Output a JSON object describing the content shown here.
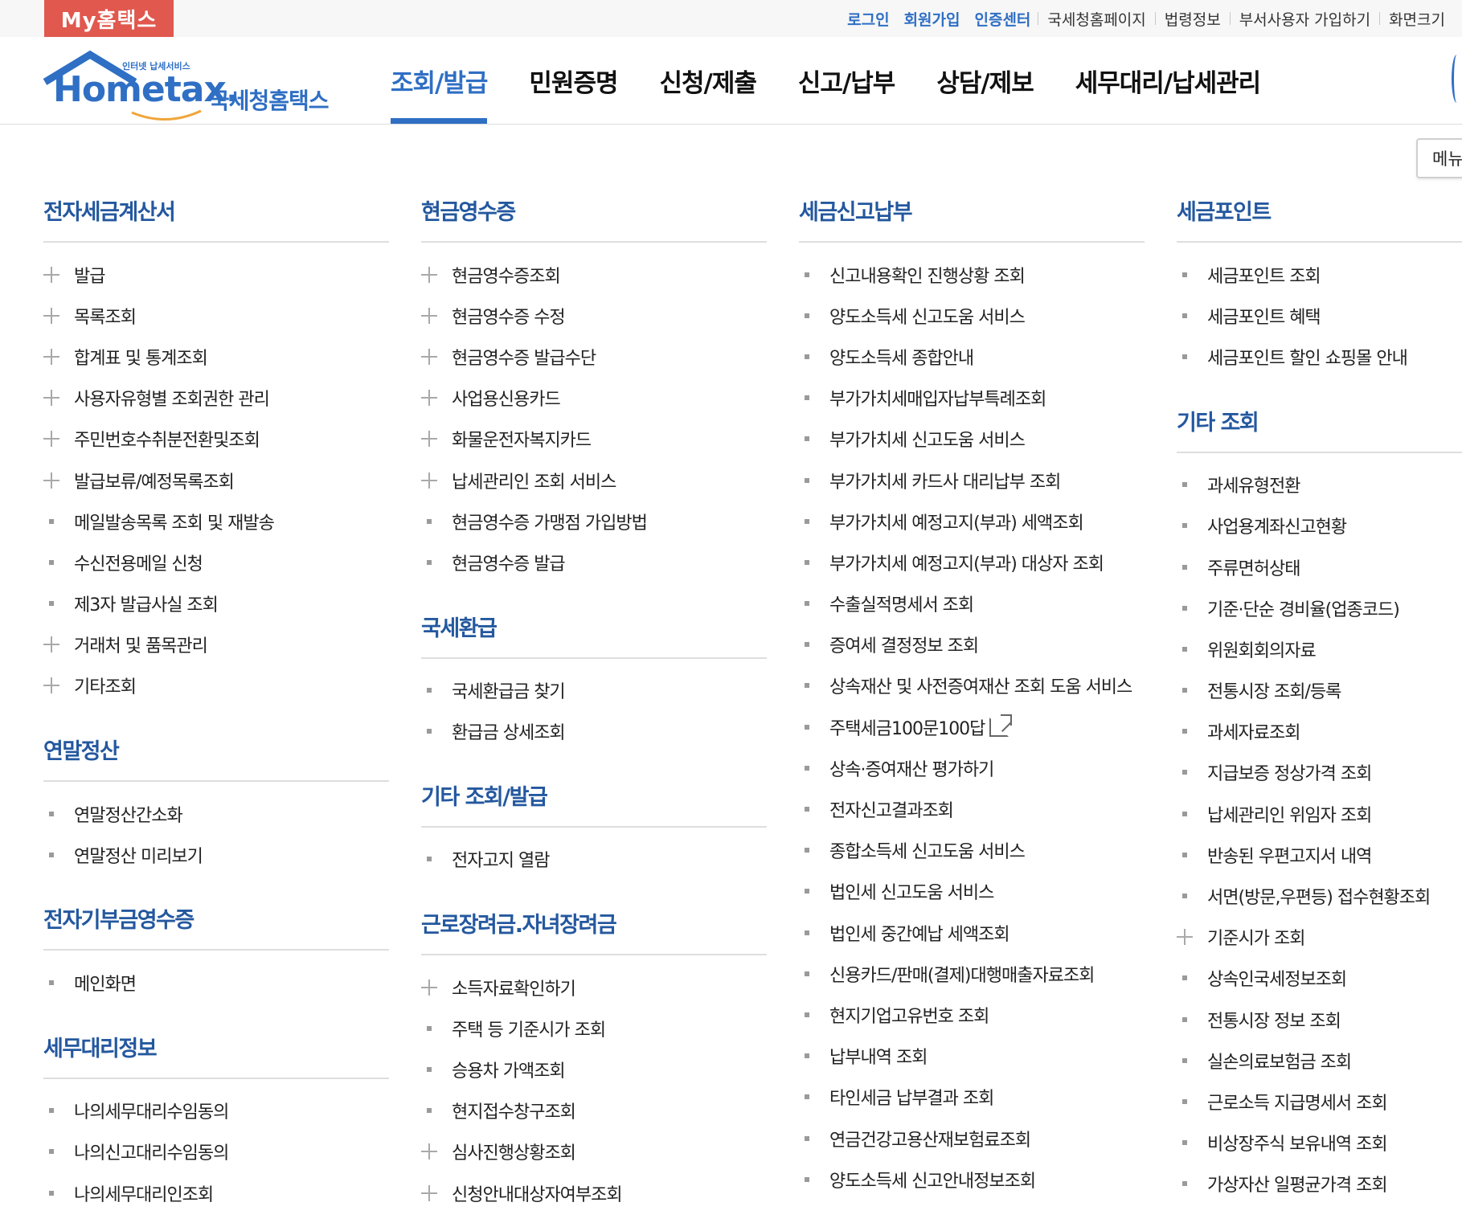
{
  "topbar": {
    "badge": "My홈택스",
    "links": [
      {
        "label": "로그인",
        "highlight": true
      },
      {
        "label": "회원가입",
        "highlight": true
      },
      {
        "label": "인증센터",
        "highlight": true
      },
      {
        "label": "국세청홈페이지",
        "highlight": false
      },
      {
        "label": "법령정보",
        "highlight": false
      },
      {
        "label": "부서사용자 가입하기",
        "highlight": false
      },
      {
        "label": "화면크기",
        "highlight": false
      }
    ]
  },
  "logo": {
    "sub": "인터넷 납세서비스",
    "main": "Hometax.",
    "kr": "국세청홈택스"
  },
  "gnb": [
    {
      "label": "조회/발급",
      "active": true
    },
    {
      "label": "민원증명",
      "active": false
    },
    {
      "label": "신청/제출",
      "active": false
    },
    {
      "label": "신고/납부",
      "active": false
    },
    {
      "label": "상담/제보",
      "active": false
    },
    {
      "label": "세무대리/납세관리",
      "active": false
    }
  ],
  "menu_button": "메뉴",
  "colors": {
    "brand": "#2f6fc4",
    "section_title": "#24589f",
    "badge": "#e0584e"
  },
  "columns": [
    [
      {
        "title": "전자세금계산서",
        "items": [
          {
            "label": "발급",
            "marker": "plus"
          },
          {
            "label": "목록조회",
            "marker": "plus"
          },
          {
            "label": "합계표 및 통계조회",
            "marker": "plus"
          },
          {
            "label": "사용자유형별 조회권한 관리",
            "marker": "plus"
          },
          {
            "label": "주민번호수취분전환및조회",
            "marker": "plus"
          },
          {
            "label": "발급보류/예정목록조회",
            "marker": "plus"
          },
          {
            "label": "메일발송목록 조회 및 재발송",
            "marker": "dot"
          },
          {
            "label": "수신전용메일 신청",
            "marker": "dot"
          },
          {
            "label": "제3자 발급사실 조회",
            "marker": "dot"
          },
          {
            "label": "거래처 및 품목관리",
            "marker": "plus"
          },
          {
            "label": "기타조회",
            "marker": "plus"
          }
        ]
      },
      {
        "title": "연말정산",
        "items": [
          {
            "label": "연말정산간소화",
            "marker": "dot"
          },
          {
            "label": "연말정산 미리보기",
            "marker": "dot"
          }
        ]
      },
      {
        "title": "전자기부금영수증",
        "items": [
          {
            "label": "메인화면",
            "marker": "dot"
          }
        ]
      },
      {
        "title": "세무대리정보",
        "items": [
          {
            "label": "나의세무대리수임동의",
            "marker": "dot"
          },
          {
            "label": "나의신고대리수임동의",
            "marker": "dot"
          },
          {
            "label": "나의세무대리인조회",
            "marker": "dot"
          }
        ]
      }
    ],
    [
      {
        "title": "현금영수증",
        "items": [
          {
            "label": "현금영수증조회",
            "marker": "plus"
          },
          {
            "label": "현금영수증 수정",
            "marker": "plus"
          },
          {
            "label": "현금영수증 발급수단",
            "marker": "plus"
          },
          {
            "label": "사업용신용카드",
            "marker": "plus"
          },
          {
            "label": "화물운전자복지카드",
            "marker": "plus"
          },
          {
            "label": "납세관리인 조회 서비스",
            "marker": "plus"
          },
          {
            "label": "현금영수증 가맹점 가입방법",
            "marker": "dot"
          },
          {
            "label": "현금영수증 발급",
            "marker": "dot"
          }
        ]
      },
      {
        "title": "국세환급",
        "items": [
          {
            "label": "국세환급금 찾기",
            "marker": "dot"
          },
          {
            "label": "환급금 상세조회",
            "marker": "dot"
          }
        ]
      },
      {
        "title": "기타 조회/발급",
        "items": [
          {
            "label": "전자고지 열람",
            "marker": "dot"
          }
        ]
      },
      {
        "title": "근로장려금.자녀장려금",
        "items": [
          {
            "label": "소득자료확인하기",
            "marker": "plus"
          },
          {
            "label": "주택 등 기준시가 조회",
            "marker": "dot"
          },
          {
            "label": "승용차 가액조회",
            "marker": "dot"
          },
          {
            "label": "현지접수창구조회",
            "marker": "dot"
          },
          {
            "label": "심사진행상황조회",
            "marker": "plus"
          },
          {
            "label": "신청안내대상자여부조회",
            "marker": "plus"
          }
        ]
      }
    ],
    [
      {
        "title": "세금신고납부",
        "items": [
          {
            "label": "신고내용확인 진행상황 조회",
            "marker": "dot"
          },
          {
            "label": "양도소득세 신고도움 서비스",
            "marker": "dot"
          },
          {
            "label": "양도소득세 종합안내",
            "marker": "dot"
          },
          {
            "label": "부가가치세매입자납부특례조회",
            "marker": "dot"
          },
          {
            "label": "부가가치세 신고도움 서비스",
            "marker": "dot"
          },
          {
            "label": "부가가치세 카드사 대리납부 조회",
            "marker": "dot"
          },
          {
            "label": "부가가치세 예정고지(부과) 세액조회",
            "marker": "dot"
          },
          {
            "label": "부가가치세 예정고지(부과) 대상자 조회",
            "marker": "dot"
          },
          {
            "label": "수출실적명세서 조회",
            "marker": "dot"
          },
          {
            "label": "증여세 결정정보 조회",
            "marker": "dot"
          },
          {
            "label": "상속재산 및 사전증여재산 조회 도움 서비스",
            "marker": "dot"
          },
          {
            "label": "주택세금100문100답",
            "marker": "dot",
            "external": true
          },
          {
            "label": "상속·증여재산 평가하기",
            "marker": "dot"
          },
          {
            "label": "전자신고결과조회",
            "marker": "dot"
          },
          {
            "label": "종합소득세 신고도움 서비스",
            "marker": "dot"
          },
          {
            "label": "법인세 신고도움 서비스",
            "marker": "dot"
          },
          {
            "label": "법인세 중간예납 세액조회",
            "marker": "dot"
          },
          {
            "label": "신용카드/판매(결제)대행매출자료조회",
            "marker": "dot"
          },
          {
            "label": "현지기업고유번호 조회",
            "marker": "dot"
          },
          {
            "label": "납부내역 조회",
            "marker": "dot"
          },
          {
            "label": "타인세금 납부결과 조회",
            "marker": "dot"
          },
          {
            "label": "연금건강고용산재보험료조회",
            "marker": "dot"
          },
          {
            "label": "양도소득세 신고안내정보조회",
            "marker": "dot"
          }
        ]
      }
    ],
    [
      {
        "title": "세금포인트",
        "items": [
          {
            "label": "세금포인트 조회",
            "marker": "dot"
          },
          {
            "label": "세금포인트 혜택",
            "marker": "dot"
          },
          {
            "label": "세금포인트 할인 쇼핑몰 안내",
            "marker": "dot"
          }
        ]
      },
      {
        "title": "기타 조회",
        "items": [
          {
            "label": "과세유형전환",
            "marker": "dot"
          },
          {
            "label": "사업용계좌신고현황",
            "marker": "dot"
          },
          {
            "label": "주류면허상태",
            "marker": "dot"
          },
          {
            "label": "기준·단순 경비율(업종코드)",
            "marker": "dot"
          },
          {
            "label": "위원회회의자료",
            "marker": "dot"
          },
          {
            "label": "전통시장 조회/등록",
            "marker": "dot"
          },
          {
            "label": "과세자료조회",
            "marker": "dot"
          },
          {
            "label": "지급보증 정상가격 조회",
            "marker": "dot"
          },
          {
            "label": "납세관리인 위임자 조회",
            "marker": "dot"
          },
          {
            "label": "반송된 우편고지서 내역",
            "marker": "dot"
          },
          {
            "label": "서면(방문,우편등) 접수현황조회",
            "marker": "dot"
          },
          {
            "label": "기준시가 조회",
            "marker": "plus"
          },
          {
            "label": "상속인국세정보조회",
            "marker": "dot"
          },
          {
            "label": "전통시장 정보 조회",
            "marker": "dot"
          },
          {
            "label": "실손의료보험금 조회",
            "marker": "dot"
          },
          {
            "label": "근로소득 지급명세서 조회",
            "marker": "dot"
          },
          {
            "label": "비상장주식 보유내역 조회",
            "marker": "dot"
          },
          {
            "label": "가상자산 일평균가격 조회",
            "marker": "dot"
          }
        ]
      }
    ]
  ]
}
